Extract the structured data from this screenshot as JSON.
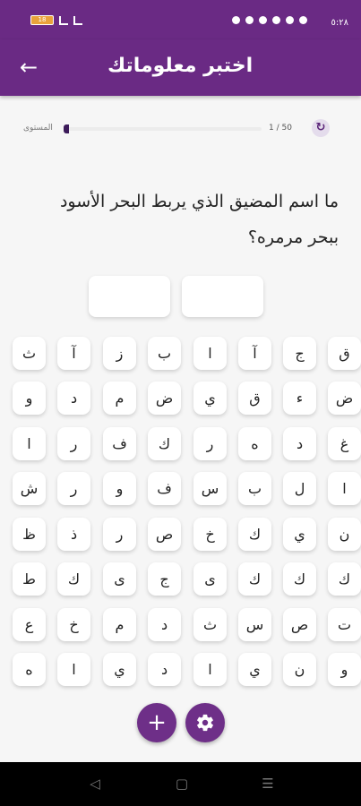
{
  "status_bar": {
    "time": "٥:٢٨",
    "battery": "18"
  },
  "header": {
    "title": "اختبر معلوماتك",
    "back_icon": "arrow-back-icon"
  },
  "level": {
    "label": "المستوى",
    "progress_text": "1 / 50",
    "progress_fraction": 0.02
  },
  "question": {
    "text": "ما اسم المضيق الذي يربط البحر الأسود ببحر مرمره؟"
  },
  "answer_slots": 2,
  "keyboard": {
    "rows": [
      [
        "ق",
        "ج",
        "آ",
        "ا",
        "ب",
        "ز",
        "آ",
        "ث"
      ],
      [
        "ض",
        "ء",
        "ق",
        "ي",
        "ض",
        "م",
        "د",
        "و"
      ],
      [
        "غ",
        "د",
        "ه",
        "ر",
        "ك",
        "ف",
        "ر",
        "ا"
      ],
      [
        "ا",
        "ل",
        "ب",
        "س",
        "ف",
        "و",
        "ر",
        "ش"
      ],
      [
        "ن",
        "ي",
        "ك",
        "خ",
        "ص",
        "ر",
        "ذ",
        "ظ"
      ],
      [
        "ك",
        "ك",
        "ك",
        "ى",
        "ج",
        "ى",
        "ك",
        "ط"
      ],
      [
        "ت",
        "ص",
        "س",
        "ث",
        "د",
        "م",
        "خ",
        "ع"
      ],
      [
        "و",
        "ن",
        "ي",
        "ا",
        "د",
        "ي",
        "ا",
        "ه"
      ]
    ]
  },
  "actions": {
    "add_hint": "+",
    "settings_icon": "gear-icon"
  },
  "nav": {
    "back": "◁",
    "home": "▢",
    "recents": "☰"
  },
  "colors": {
    "primary": "#6a2a84",
    "fab": "#6e2f88",
    "background": "#f6f6f6"
  }
}
